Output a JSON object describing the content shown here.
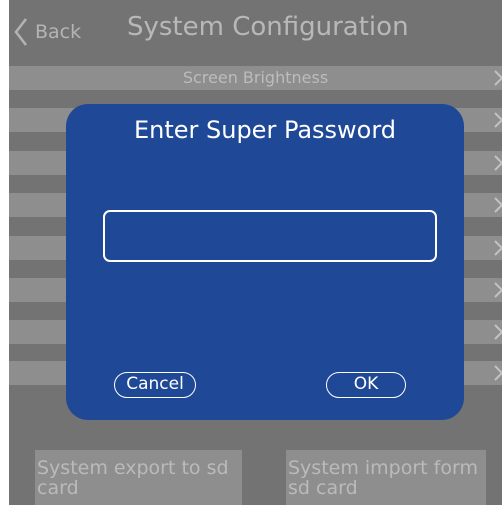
{
  "header": {
    "back_label": "Back",
    "title": "System Configuration"
  },
  "menu": {
    "items": [
      {
        "label": "Screen Brightness"
      },
      {
        "label": ""
      },
      {
        "label": ""
      },
      {
        "label": ""
      },
      {
        "label": ""
      },
      {
        "label": ""
      },
      {
        "label": ""
      },
      {
        "label": ""
      },
      {
        "label": ""
      }
    ]
  },
  "bottom": {
    "export_label": "System export to sd card",
    "import_label": "System import form sd card"
  },
  "dialog": {
    "title": "Enter Super Password",
    "password_value": "",
    "cancel_label": "Cancel",
    "ok_label": "OK"
  },
  "colors": {
    "dialog_bg": "#1f4896",
    "screen_bg": "#7f7f7f",
    "row_bg": "#a0a0a0"
  },
  "icons": {
    "back": "chevron-left-icon",
    "row_arrow": "chevron-right-icon"
  }
}
